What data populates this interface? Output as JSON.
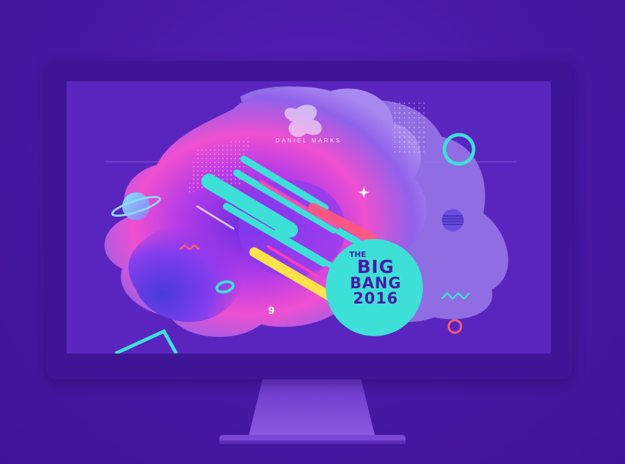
{
  "designer": {
    "name": "DANIEL MARKS"
  },
  "event": {
    "line1": "THE",
    "line2": "BIG",
    "line3": "BANG",
    "line4": "2016"
  },
  "colors": {
    "background": "#4a1aa8",
    "bezel": "#3e1595",
    "screen": "#5a25bf",
    "teal": "#3de0d6",
    "pink": "#ff3fb5",
    "yellow": "#ffe24a",
    "coral": "#ff5a7a",
    "violet": "#8a3cf0"
  },
  "icons": [
    "monitor-icon",
    "planet-icon",
    "ring-icon",
    "circle-outline-icon",
    "triangle-outline-icon",
    "zigzag-icon",
    "sparkle-icon",
    "nine-glyph-icon"
  ]
}
